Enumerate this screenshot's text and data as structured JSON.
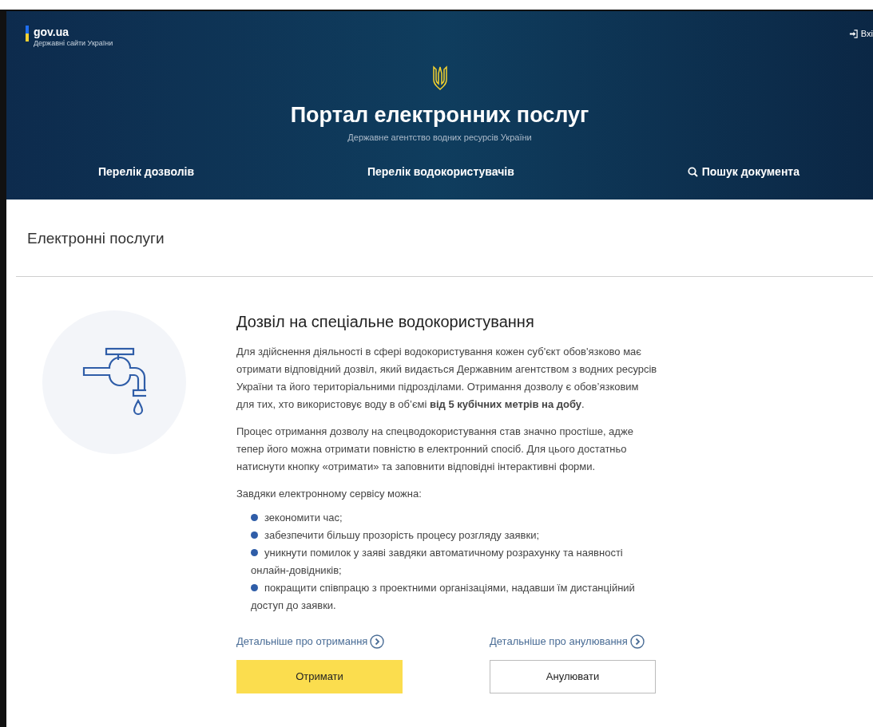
{
  "header": {
    "brand": {
      "name": "gov.ua",
      "tagline": "Державні сайти України"
    },
    "sign_in": "Вхі",
    "title": "Портал електронних послуг",
    "subtitle": "Державне агентство водних ресурсів України",
    "nav": [
      {
        "label": "Перелік дозволів",
        "kind": "plain"
      },
      {
        "label": "Перелік водокористувачів",
        "kind": "plain"
      },
      {
        "label": "Пошук документа",
        "kind": "search"
      }
    ]
  },
  "page_title": "Електронні послуги",
  "service": {
    "title": "Дозвіл на спеціальне водокористування",
    "paragraphs": [
      "Для здійснення діяльності в сфері водокористування кожен суб'єкт обов'язково має отримати відповідний дозвіл, який видається Державним агентством з водних ресурсів України та його територіальними підрозділами. Отримання дозволу є обов’язковим для тих, хто використовує воду в об’ємі **від 5 кубічних метрів на добу**.",
      "Процес отримання дозволу на спецводокористування став значно простіше, адже тепер його можна отримати повністю в електронний спосіб. Для цього достатньо натиснути кнопку «отримати» та заповнити відповідні інтерактивні форми.",
      "Завдяки електронному сервісу можна:"
    ],
    "benefits": [
      "зекономити час;",
      "забезпечити більшу прозорість процесу розгляду заявки;",
      "уникнути помилок у заяві завдяки автоматичному розрахунку та наявності онлайн-довідників;",
      "покращити співпрацю з проектними організаціями, надавши їм дистанційний доступ до заявки."
    ],
    "actions": [
      {
        "link": "Детальніше про отримання",
        "button": "Отримати",
        "kind": "primary"
      },
      {
        "link": "Детальніше про анулювання",
        "button": "Анулювати",
        "kind": "secondary"
      }
    ]
  }
}
